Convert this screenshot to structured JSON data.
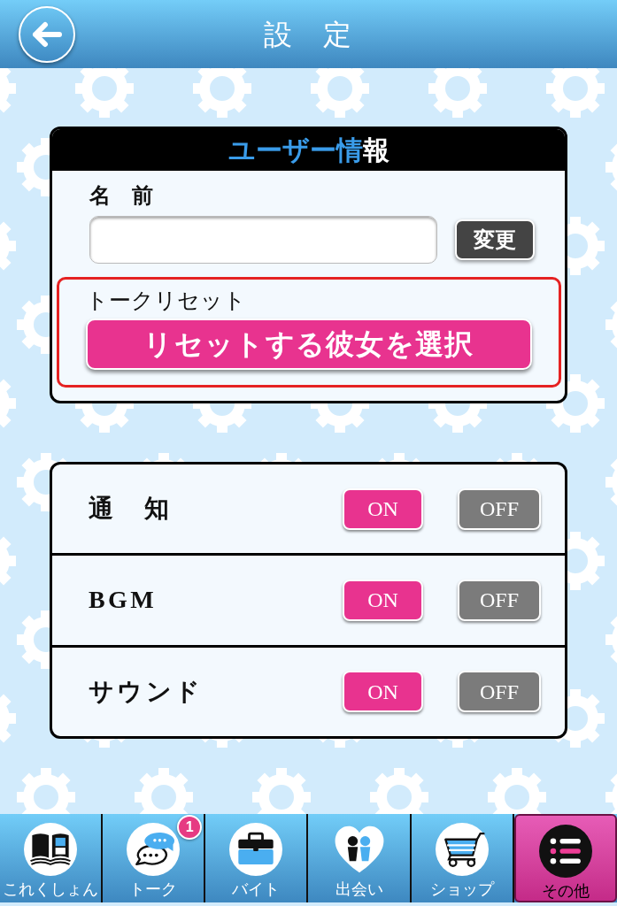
{
  "header": {
    "title": "設　定"
  },
  "user_info": {
    "title_parts": [
      {
        "text": "ユーザー情",
        "color": "#3a9cea"
      },
      {
        "text": "報",
        "color": "#ffffff"
      }
    ],
    "name_label": "名　前",
    "change_button": "変更",
    "talk_reset": {
      "label": "トークリセット",
      "button": "リセットする彼女を選択"
    }
  },
  "settings": [
    {
      "label": "通　知",
      "on_button": "ON",
      "off_button": "OFF",
      "on": true
    },
    {
      "label": "BGM",
      "on_button": "ON",
      "off_button": "OFF",
      "on": true
    },
    {
      "label": "サウンド",
      "on_button": "ON",
      "off_button": "OFF",
      "on": true
    }
  ],
  "tab_bar": [
    {
      "kind": "book",
      "label": "これくしょん",
      "selected": false
    },
    {
      "kind": "chat",
      "label": "トーク",
      "badge": "1",
      "selected": false
    },
    {
      "kind": "briefcase",
      "label": "バイト",
      "selected": false
    },
    {
      "kind": "heart",
      "label": "出会い",
      "selected": false
    },
    {
      "kind": "cart",
      "label": "ショップ",
      "selected": false
    },
    {
      "kind": "list",
      "label": "その他",
      "selected": true
    }
  ]
}
